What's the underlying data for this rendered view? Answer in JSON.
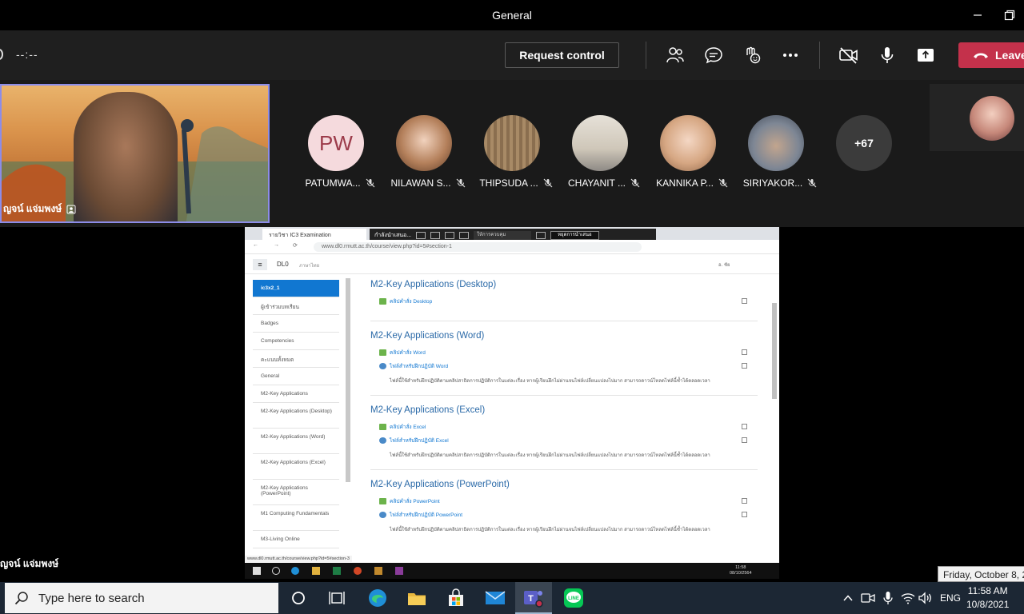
{
  "window": {
    "title": "General"
  },
  "toolbar": {
    "timer": "--:--",
    "request_control_label": "Request control",
    "leave_label": "Leave"
  },
  "presenter": {
    "name": "ญจน์ แจ่มพงษ์"
  },
  "participants": [
    {
      "initials": "PW",
      "name": "PATUMWA..."
    },
    {
      "name": "NILAWAN S..."
    },
    {
      "name": "THIPSUDA ..."
    },
    {
      "name": "CHAYANIT ..."
    },
    {
      "name": "KANNIKA P..."
    },
    {
      "name": "SIRIYAKOR..."
    }
  ],
  "more_participants": "+67",
  "shared_screen": {
    "browser_tab": "รายวิชา IC3 Examination",
    "sharing_label": "กำลังนำเสนอ...",
    "control_dropdown": "ให้การควบคุม",
    "stop_presenting": "หยุดการนำเสนอ",
    "url": "www.dl0.rmutt.ac.th/course/view.php?id=5#section-1",
    "site_name": "DL0",
    "site_lang": "ภาษาไทย",
    "user_label": "อ. ชัย",
    "sidebar": [
      "ic3x2_1",
      "ผู้เข้าร่วมบทเรียน",
      "Badges",
      "Competencies",
      "คะแนนทั้งหมด",
      "General",
      "M2-Key Applications",
      "M2-Key Applications (Desktop)",
      "M2-Key Applications (Word)",
      "M2-Key Applications (Excel)",
      "M2-Key Applications (PowerPoint)",
      "M1 Computing Fundamentals",
      "M3-Living Online"
    ],
    "sections": [
      {
        "title": "M2-Key Applications (Desktop)",
        "activities": [
          "คลิปคำสั่ง Desktop"
        ]
      },
      {
        "title": "M2-Key Applications (Word)",
        "activities": [
          "คลิปคำสั่ง Word",
          "ไฟล์สำหรับฝึกปฏิบัติ Word"
        ],
        "description": "ไฟล์นี้ใช้สำหรับฝึกปฏิบัติตามคลิปสาธิตการปฏิบัติการในแต่ละเรื่อง หากผู้เรียนฝึกไม่ผ่านจนไฟล์เปลี่ยนแปลงไปมาก สามารถดาวน์โหลดไฟล์นี้ซ้ำได้ตลอดเวลา"
      },
      {
        "title": "M2-Key Applications (Excel)",
        "activities": [
          "คลิปคำสั่ง Excel",
          "ไฟล์สำหรับฝึกปฏิบัติ Excel"
        ],
        "description": "ไฟล์นี้ใช้สำหรับฝึกปฏิบัติตามคลิปสาธิตการปฏิบัติการในแต่ละเรื่อง หากผู้เรียนฝึกไม่ผ่านจนไฟล์เปลี่ยนแปลงไปมาก สามารถดาวน์โหลดไฟล์นี้ซ้ำได้ตลอดเวลา"
      },
      {
        "title": "M2-Key Applications (PowerPoint)",
        "activities": [
          "คลิปคำสั่ง PowerPoint",
          "ไฟล์สำหรับฝึกปฏิบัติ PowerPoint"
        ],
        "description": "ไฟล์นี้ใช้สำหรับฝึกปฏิบัติตามคลิปสาธิตการปฏิบัติการในแต่ละเรื่อง หากผู้เรียนฝึกไม่ผ่านจนไฟล์เปลี่ยนแปลงไปมาก สามารถดาวน์โหลดไฟล์นี้ซ้ำได้ตลอดเวลา"
      }
    ],
    "status_url": "www.dl0.rmutt.ac.th/course/view.php?id=5#section-3",
    "inner_clock_time": "11:58",
    "inner_clock_date": "08/10/2564"
  },
  "date_tooltip": "Friday, October 8, 2021",
  "taskbar": {
    "search_placeholder": "Type here to search",
    "language": "ENG",
    "time": "11:58 AM",
    "date": "10/8/2021"
  },
  "colors": {
    "leave": "#c4314b",
    "active_border": "#8c8ce8",
    "moodle_blue": "#1177d1",
    "taskbar": "#1c2734"
  }
}
